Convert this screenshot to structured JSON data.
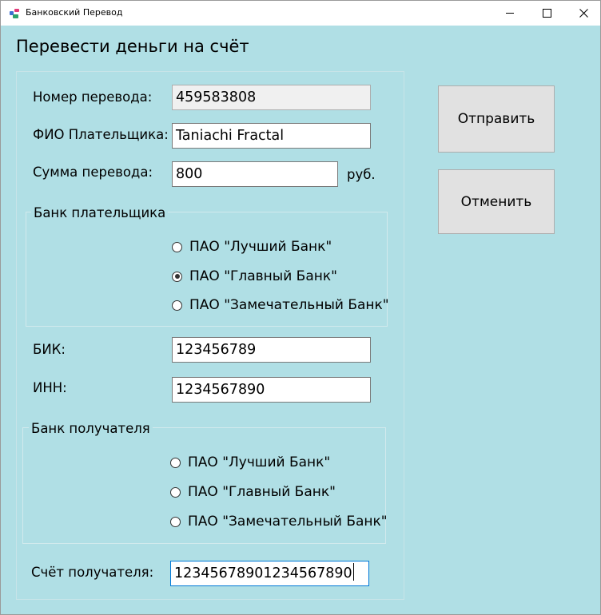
{
  "window": {
    "title": "Банковский Перевод",
    "icon": "app-icon",
    "controls": {
      "minimize": "minimize-icon",
      "maximize": "maximize-icon",
      "close": "close-icon"
    }
  },
  "form": {
    "heading": "Перевести деньги на счёт",
    "transfer_number": {
      "label": "Номер перевода:",
      "value": "459583808"
    },
    "payer_name": {
      "label": "ФИО Плательщика:",
      "value": "Taniachi Fractal"
    },
    "amount": {
      "label": "Сумма перевода:",
      "value": "800",
      "unit": "руб."
    },
    "payer_bank": {
      "caption": "Банк плательщика",
      "options": [
        "ПАО \"Лучший Банк\"",
        "ПАО \"Главный Банк\"",
        "ПАО \"Замечательный Банк\""
      ],
      "selected": "ПАО \"Главный Банк\""
    },
    "bik": {
      "label": "БИК:",
      "value": "123456789"
    },
    "inn": {
      "label": "ИНН:",
      "value": "1234567890"
    },
    "recipient_bank": {
      "caption": "Банк получателя",
      "options": [
        "ПАО \"Лучший Банк\"",
        "ПАО \"Главный Банк\"",
        "ПАО \"Замечательный Банк\""
      ],
      "selected": null
    },
    "recipient_account": {
      "label": "Счёт получателя:",
      "value": "12345678901234567890"
    }
  },
  "buttons": {
    "send": "Отправить",
    "cancel": "Отменить"
  }
}
